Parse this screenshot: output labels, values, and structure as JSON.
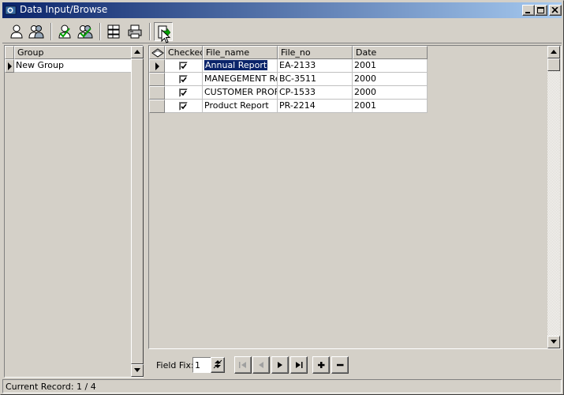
{
  "window": {
    "title": "Data Input/Browse"
  },
  "toolbar": {
    "buttons": [
      {
        "icon": "person-icon"
      },
      {
        "icon": "people-icon"
      },
      {
        "icon": "person-check-icon"
      },
      {
        "icon": "people-check-icon"
      },
      {
        "icon": "layout-icon"
      },
      {
        "icon": "printer-icon"
      },
      {
        "icon": "export-icon"
      }
    ]
  },
  "groups": {
    "header": "Group",
    "rows": [
      "New Group"
    ]
  },
  "records": {
    "columns": [
      "Checked",
      "File_name",
      "File_no",
      "Date"
    ],
    "rows": [
      {
        "checked": true,
        "file_name": "Annual Report",
        "file_no": "EA-2133",
        "date": "2001"
      },
      {
        "checked": true,
        "file_name": "MANEGEMENT Re",
        "file_no": "BC-3511",
        "date": "2000"
      },
      {
        "checked": true,
        "file_name": "CUSTOMER PROF",
        "file_no": "CP-1533",
        "date": "2000"
      },
      {
        "checked": true,
        "file_name": "Product Report",
        "file_no": "PR-2214",
        "date": "2001"
      }
    ]
  },
  "navigator": {
    "field_fix_label": "Field Fix:",
    "field_fix_value": "1"
  },
  "status": {
    "text": "Current Record: 1 / 4"
  },
  "colors": {
    "title_start": "#0a246a",
    "title_end": "#a6caf0",
    "face": "#d4d0c8",
    "selection": "#0a246a"
  }
}
